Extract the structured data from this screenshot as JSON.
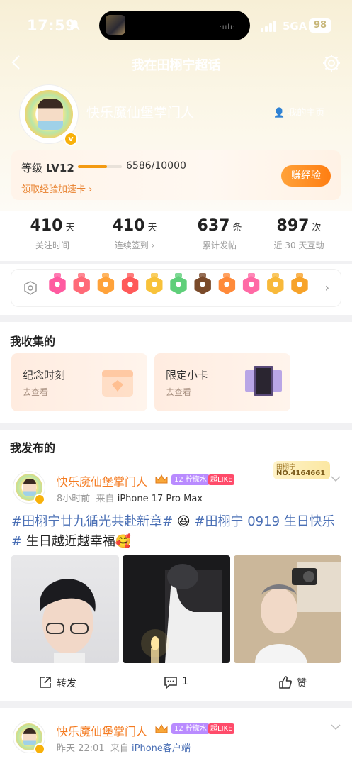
{
  "status_bar": {
    "time": "17:59",
    "network": "5GA",
    "battery": "98"
  },
  "nav": {
    "title": "我在田栩宁超话"
  },
  "profile": {
    "username": "快乐魔仙堡掌门人",
    "home_link": "我的主页"
  },
  "level": {
    "label": "等级",
    "level": "LV12",
    "progress_text": "6586/10000",
    "progress_fraction": 0.6586,
    "accel_card": "领取经验加速卡 ›",
    "earn_button": "赚经验"
  },
  "stats": [
    {
      "value": "410",
      "unit": "天",
      "label": "关注时间"
    },
    {
      "value": "410",
      "unit": "天",
      "label": "连续签到 ›"
    },
    {
      "value": "637",
      "unit": "条",
      "label": "累计发帖"
    },
    {
      "value": "897",
      "unit": "次",
      "label": "近 30 天互动"
    }
  ],
  "badges": {
    "colors": [
      "#ff5aa0",
      "#ff6a78",
      "#ffa23a",
      "#ff5a5a",
      "#f8c23a",
      "#5fcf7a",
      "#7a4a2a",
      "#ff8a3a",
      "#ff6aa5",
      "#f8b93a",
      "#f7a32a"
    ]
  },
  "collection": {
    "title": "我收集的",
    "cards": [
      {
        "title": "纪念时刻",
        "sub": "去查看"
      },
      {
        "title": "限定小卡",
        "sub": "去查看"
      }
    ]
  },
  "posts_section": {
    "title": "我发布的"
  },
  "post1": {
    "name": "快乐魔仙堡掌门人",
    "level_tag": "12 柠檬水",
    "like_tag": "超LIKE",
    "time": "8小时前",
    "via": "来自",
    "device": "iPhone 17 Pro Max",
    "badge_top": "田栩宁",
    "badge_no": "NO.4164661",
    "text_topic1": "#田栩宁廿九循光共赴新章#",
    "text_topic2": "#田栩宁 0919 生日快乐#",
    "text_plain": " 生日越近越幸福",
    "repost": "转发",
    "comments": "1",
    "like": "赞"
  },
  "post2": {
    "name": "快乐魔仙堡掌门人",
    "level_tag": "12 柠檬水",
    "like_tag": "超LIKE",
    "time": "昨天 22:01",
    "via": "来自",
    "device": "iPhone客户端"
  }
}
